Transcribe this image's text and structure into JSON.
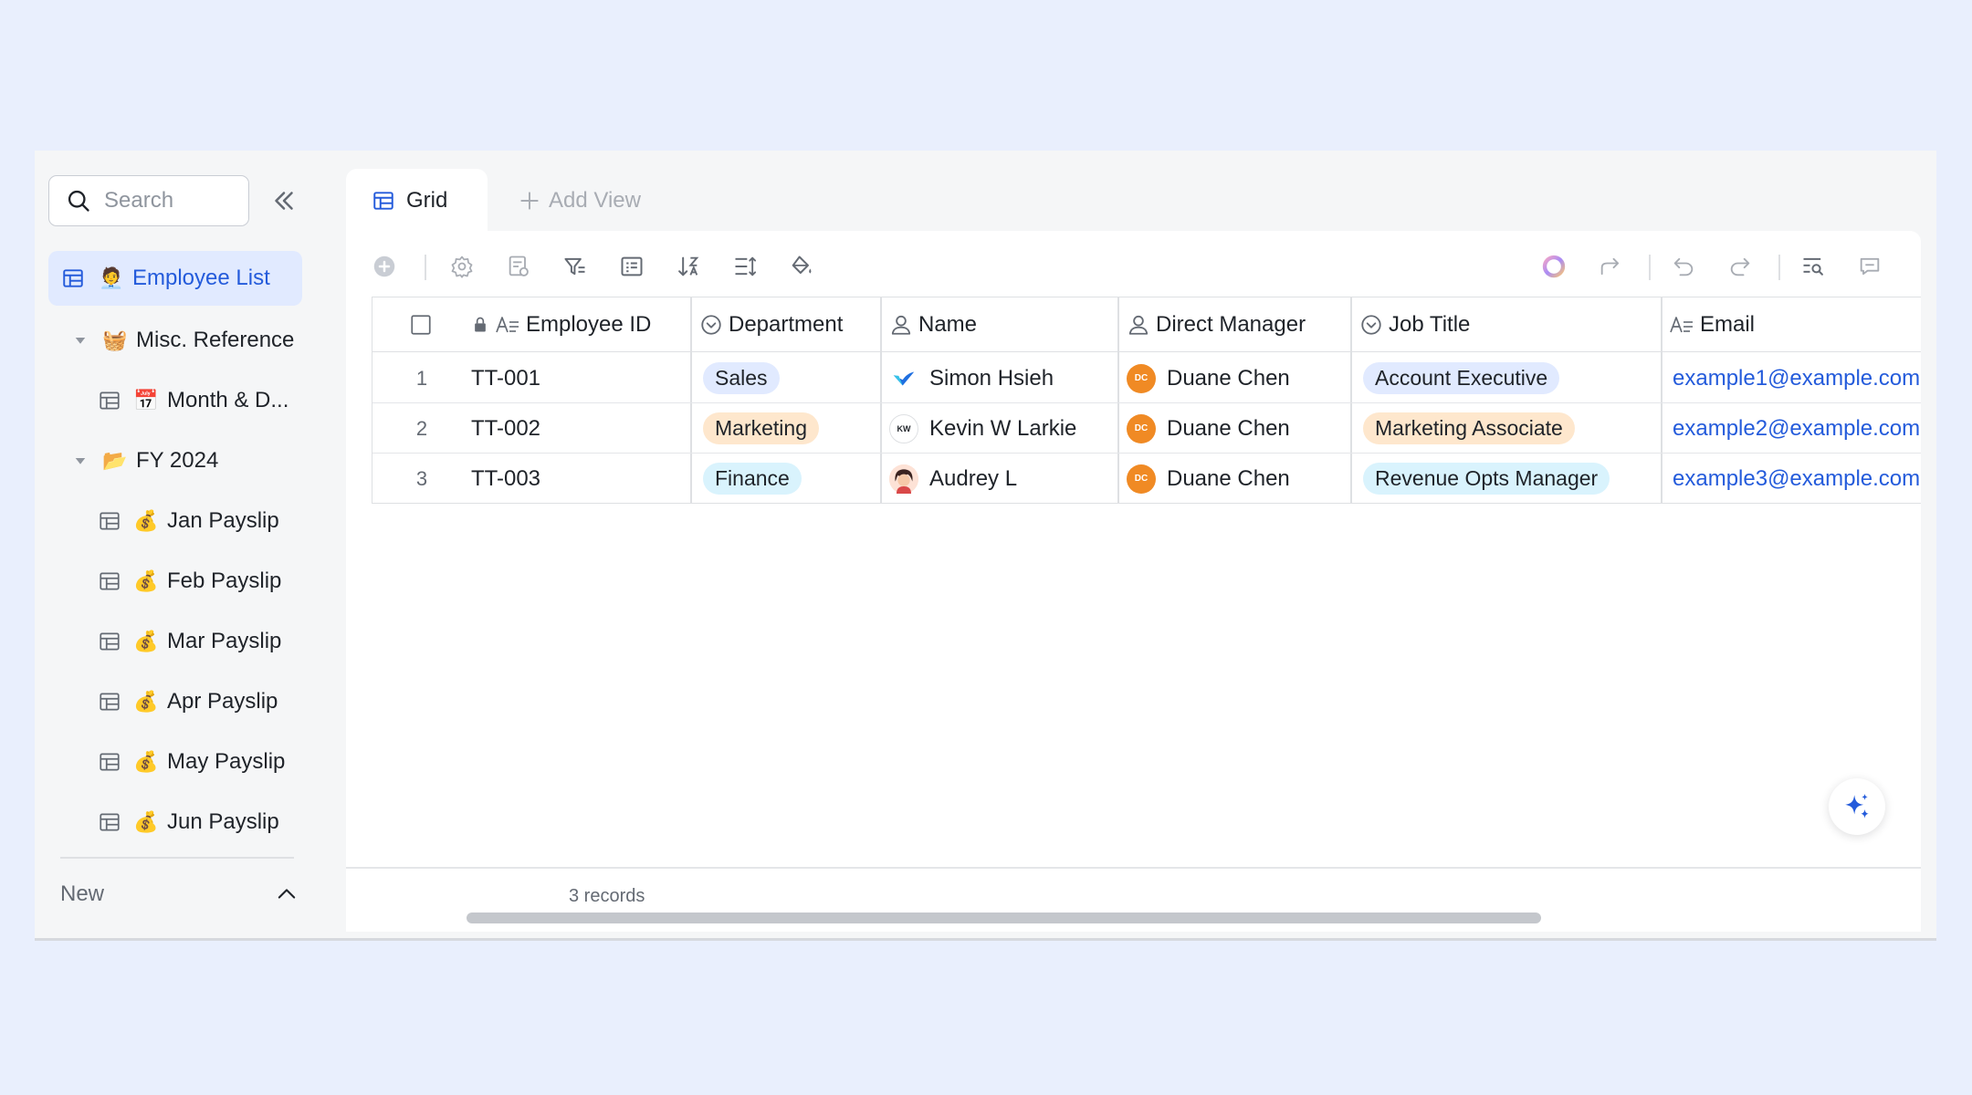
{
  "sidebar": {
    "search_placeholder": "Search",
    "items": [
      {
        "label": "Employee List",
        "emoji": "🧑‍💼"
      },
      {
        "label": "Misc. Reference",
        "emoji": "🧺"
      },
      {
        "label": "Month & D...",
        "emoji": "📅"
      },
      {
        "label": "FY 2024",
        "emoji": "📂"
      },
      {
        "label": "Jan Payslip",
        "emoji": "💰"
      },
      {
        "label": "Feb Payslip",
        "emoji": "💰"
      },
      {
        "label": "Mar Payslip",
        "emoji": "💰"
      },
      {
        "label": "Apr Payslip",
        "emoji": "💰"
      },
      {
        "label": "May Payslip",
        "emoji": "💰"
      },
      {
        "label": "Jun Payslip",
        "emoji": "💰"
      }
    ],
    "new_label": "New"
  },
  "tabs": {
    "grid_label": "Grid",
    "add_view_label": "Add View"
  },
  "table": {
    "columns": [
      "Employee ID",
      "Department",
      "Name",
      "Direct Manager",
      "Job Title",
      "Email"
    ],
    "rows": [
      {
        "num": "1",
        "id": "TT-001",
        "department": "Sales",
        "name": "Simon Hsieh",
        "manager": "Duane Chen",
        "manager_initials": "DC",
        "job_title": "Account Executive",
        "email": "example1@example.com"
      },
      {
        "num": "2",
        "id": "TT-002",
        "department": "Marketing",
        "name": "Kevin W Larkie",
        "name_initials": "KW",
        "manager": "Duane Chen",
        "manager_initials": "DC",
        "job_title": "Marketing Associate",
        "email": "example2@example.com"
      },
      {
        "num": "3",
        "id": "TT-003",
        "department": "Finance",
        "name": "Audrey L",
        "manager": "Duane Chen",
        "manager_initials": "DC",
        "job_title": "Revenue Opts Manager",
        "email": "example3@example.com"
      }
    ]
  },
  "footer": {
    "records": "3 records"
  },
  "colors": {
    "accent": "#245bdb",
    "active_bg": "#e1eaff",
    "tag_sales": "#e1eaff",
    "tag_marketing": "#fee7cd",
    "tag_finance": "#d9f3fd",
    "tag_account_exec": "#e1eaff",
    "tag_marketing_assoc": "#fee7cd",
    "tag_revenue": "#d9f3fd",
    "manager_avatar": "#f08a24"
  }
}
